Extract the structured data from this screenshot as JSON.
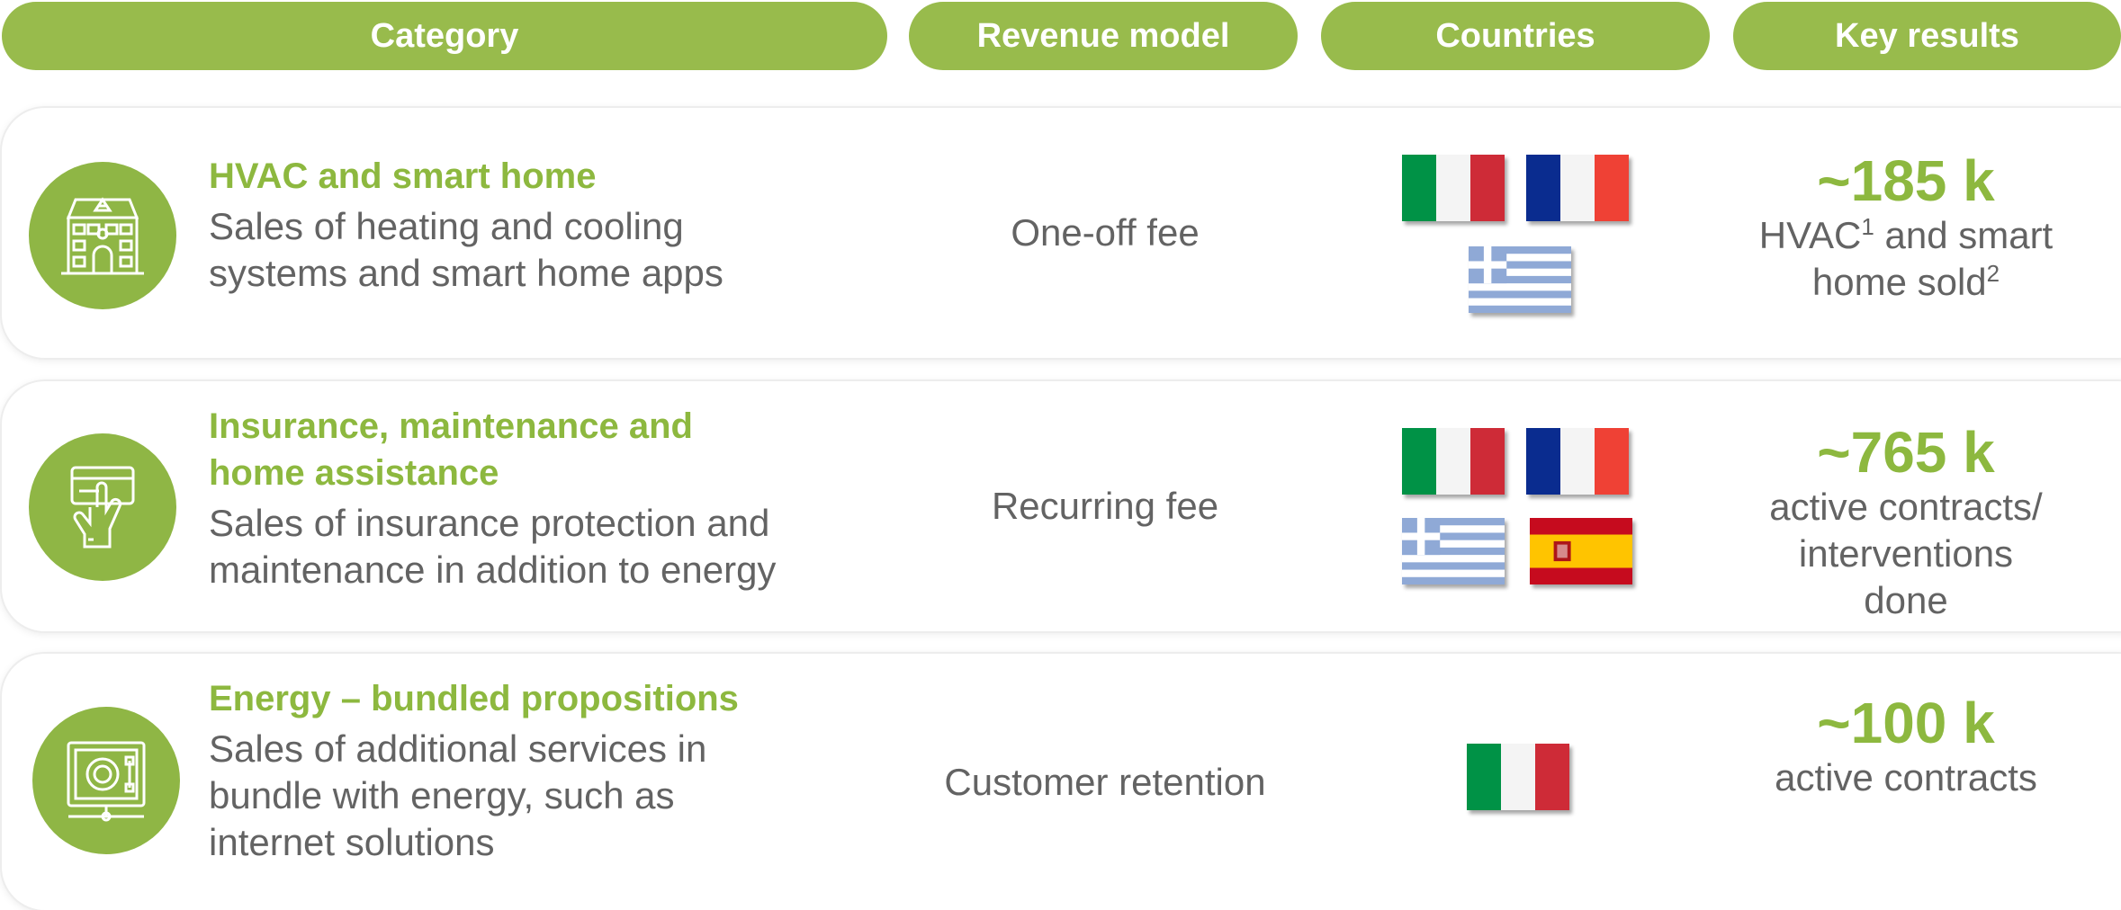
{
  "headers": {
    "category": "Category",
    "revenue_model": "Revenue model",
    "countries": "Countries",
    "key_results": "Key results"
  },
  "colors": {
    "accent": "#98bb4c",
    "title_green": "#8db83f",
    "body_gray": "#636363"
  },
  "rows": [
    {
      "icon": "house-icon",
      "title": "HVAC and smart home",
      "description": "Sales of heating and cooling systems and smart home apps",
      "revenue_model": "One-off fee",
      "countries": [
        "Italy",
        "France",
        "Greece"
      ],
      "key_value": "~185 k",
      "key_desc_part1": "HVAC",
      "key_desc_sup1": "1",
      "key_desc_part2": " and smart home sold",
      "key_desc_sup2": "2"
    },
    {
      "icon": "hand-card-icon",
      "title": "Insurance, maintenance and home assistance",
      "description": "Sales of insurance protection and maintenance in addition to energy",
      "revenue_model": "Recurring fee",
      "countries": [
        "Italy",
        "France",
        "Greece",
        "Spain"
      ],
      "key_value": "~765 k",
      "key_desc": "active contracts/ interventions done"
    },
    {
      "icon": "safe-icon",
      "title": "Energy – bundled propositions",
      "description": "Sales of additional services in bundle with energy, such as internet solutions",
      "revenue_model": "Customer retention",
      "countries": [
        "Italy"
      ],
      "key_value": "~100 k",
      "key_desc": "active contracts"
    }
  ]
}
